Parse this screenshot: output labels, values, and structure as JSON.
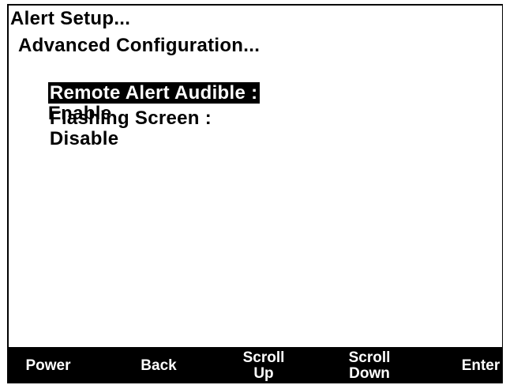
{
  "menu": {
    "title": "Alert Setup...",
    "submenu": "Advanced Configuration...",
    "items": [
      {
        "label": "Remote Alert Audible :",
        "value": "Enable",
        "selected": true
      },
      {
        "label": "Flashing Screen :",
        "value": "Disable",
        "selected": false
      }
    ]
  },
  "softkeys": {
    "power": "Power",
    "back": "Back",
    "scroll_up_line1": "Scroll",
    "scroll_up_line2": "Up",
    "scroll_down_line1": "Scroll",
    "scroll_down_line2": "Down",
    "enter": "Enter"
  },
  "colors": {
    "background": "#ffffff",
    "foreground": "#000000",
    "highlight_bg": "#000000",
    "highlight_fg": "#ffffff"
  }
}
